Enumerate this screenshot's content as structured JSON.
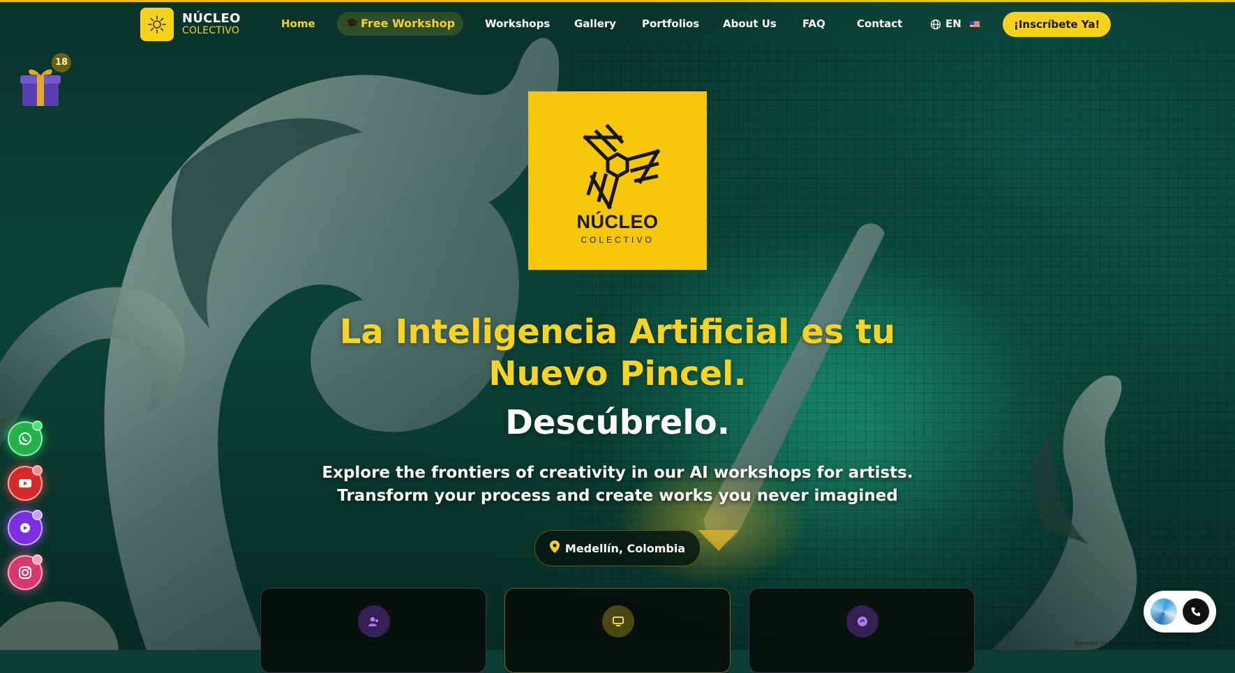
{
  "header": {
    "brand_title": "NÚCLEO",
    "brand_subtitle": "COLECTIVO",
    "nav": [
      {
        "label": "Home",
        "active": true
      },
      {
        "label": "Free Workshop",
        "icon": "graduation-cap-icon"
      },
      {
        "label": "Workshops"
      },
      {
        "label": "Gallery"
      },
      {
        "label": "Portfolios"
      },
      {
        "label": "About Us"
      },
      {
        "label": "FAQ"
      },
      {
        "label": "Contact"
      }
    ],
    "language": "EN",
    "cta_label": "¡Inscríbete Ya!"
  },
  "gift": {
    "count": "18"
  },
  "logo": {
    "title": "NÚCLEO",
    "subtitle": "COLECTIVO"
  },
  "hero": {
    "title_line1": "La Inteligencia Artificial es tu",
    "title_line2": "Nuevo Pincel.",
    "cta_text": "Descúbrelo.",
    "subtitle_line1": "Explore the frontiers of creativity in our AI workshops for artists.",
    "subtitle_line2": "Transform your process and create works you never imagined",
    "location": "Medellín, Colombia"
  },
  "cards": [
    {
      "icon": "users-icon",
      "color": "#8a3fd6"
    },
    {
      "icon": "monitor-icon",
      "color": "#c9b21a"
    },
    {
      "icon": "palette-icon",
      "color": "#8a3fd6"
    }
  ],
  "social": [
    "whatsapp-icon",
    "youtube-icon",
    "play-icon",
    "instagram-icon"
  ],
  "colors": {
    "accent": "#f5d21b",
    "background": "#0c3d33",
    "cta_text": "#1a1a1a"
  },
  "footer": {
    "powered": "Powered by ElevenLabs Conversational AI"
  }
}
